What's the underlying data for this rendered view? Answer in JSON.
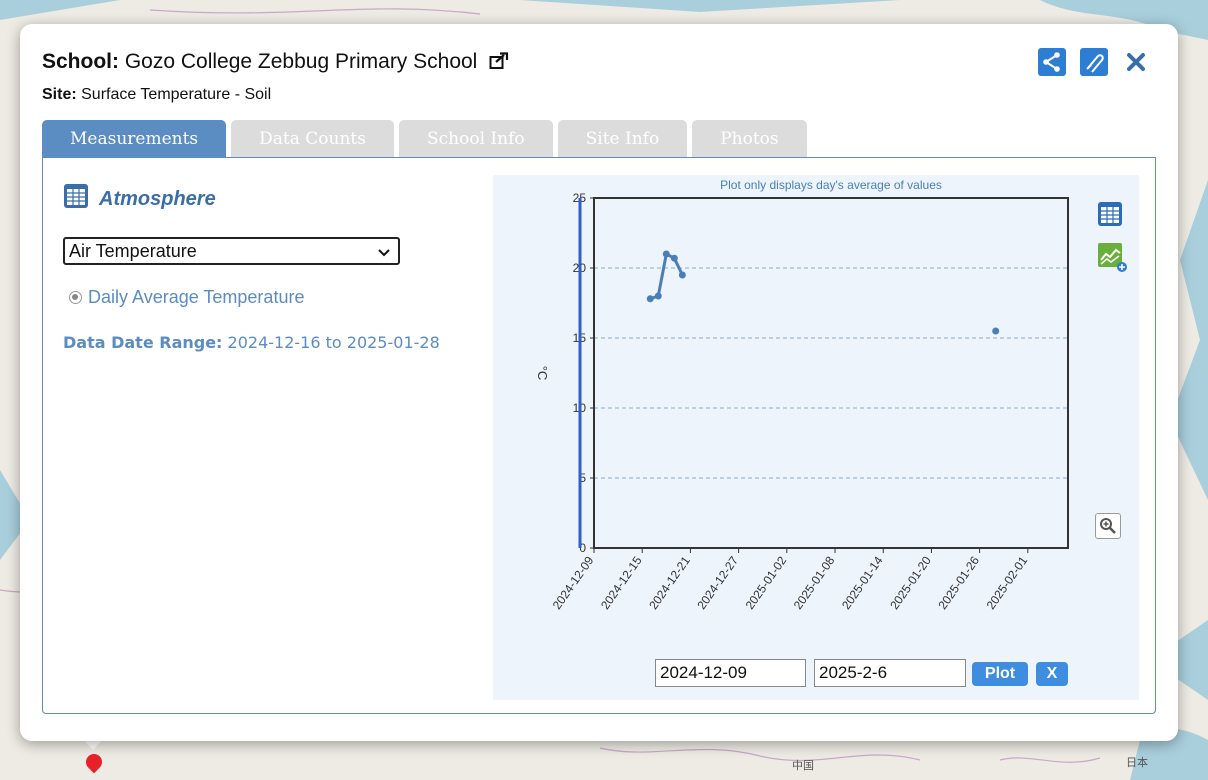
{
  "school": {
    "label": "School:",
    "name": "Gozo College Zebbug Primary School"
  },
  "site": {
    "label": "Site:",
    "name": "Surface Temperature - Soil"
  },
  "tabs": [
    {
      "label": "Measurements",
      "active": true
    },
    {
      "label": "Data Counts",
      "active": false
    },
    {
      "label": "School Info",
      "active": false
    },
    {
      "label": "Site Info",
      "active": false
    },
    {
      "label": "Photos",
      "active": false
    }
  ],
  "measurements": {
    "category": "Atmosphere",
    "select_value": "Air Temperature",
    "radio_label": "Daily Average Temperature",
    "range_label": "Data Date Range:",
    "range_value": "2024-12-16 to 2025-01-28"
  },
  "plot": {
    "start_date": "2024-12-09",
    "end_date": "2025-2-6",
    "plot_button": "Plot",
    "clear_button": "X"
  },
  "map_labels": {
    "china": "中国",
    "japan": "日本"
  },
  "colors": {
    "accent": "#5b8cc2",
    "line": "#4a7ebb",
    "button": "#3e8de0"
  },
  "icons": [
    "external-link-icon",
    "share-icon",
    "edit-icon",
    "close-icon",
    "table-icon",
    "add-chart-icon",
    "zoom-icon"
  ],
  "chart_data": {
    "type": "line",
    "title": "Plot only displays day's average of values",
    "ylabel": "°C",
    "xlabel": "",
    "ylim": [
      0,
      25
    ],
    "xlim": [
      "2024-12-09",
      "2025-02-06"
    ],
    "yticks": [
      "0",
      "5",
      "10",
      "15",
      "20",
      "25"
    ],
    "xticks": [
      "2024-12-09",
      "2024-12-15",
      "2024-12-21",
      "2024-12-27",
      "2025-01-02",
      "2025-01-08",
      "2025-01-14",
      "2025-01-20",
      "2025-01-26",
      "2025-02-01"
    ],
    "grid": true,
    "series": [
      {
        "points": [
          {
            "x": "2024-12-16",
            "y": 17.8
          },
          {
            "x": "2024-12-17",
            "y": 18.0
          },
          {
            "x": "2024-12-18",
            "y": 21.0
          },
          {
            "x": "2024-12-19",
            "y": 20.7
          },
          {
            "x": "2024-12-20",
            "y": 19.5
          },
          {
            "x": "2025-01-28",
            "y": 15.5
          }
        ]
      }
    ]
  }
}
